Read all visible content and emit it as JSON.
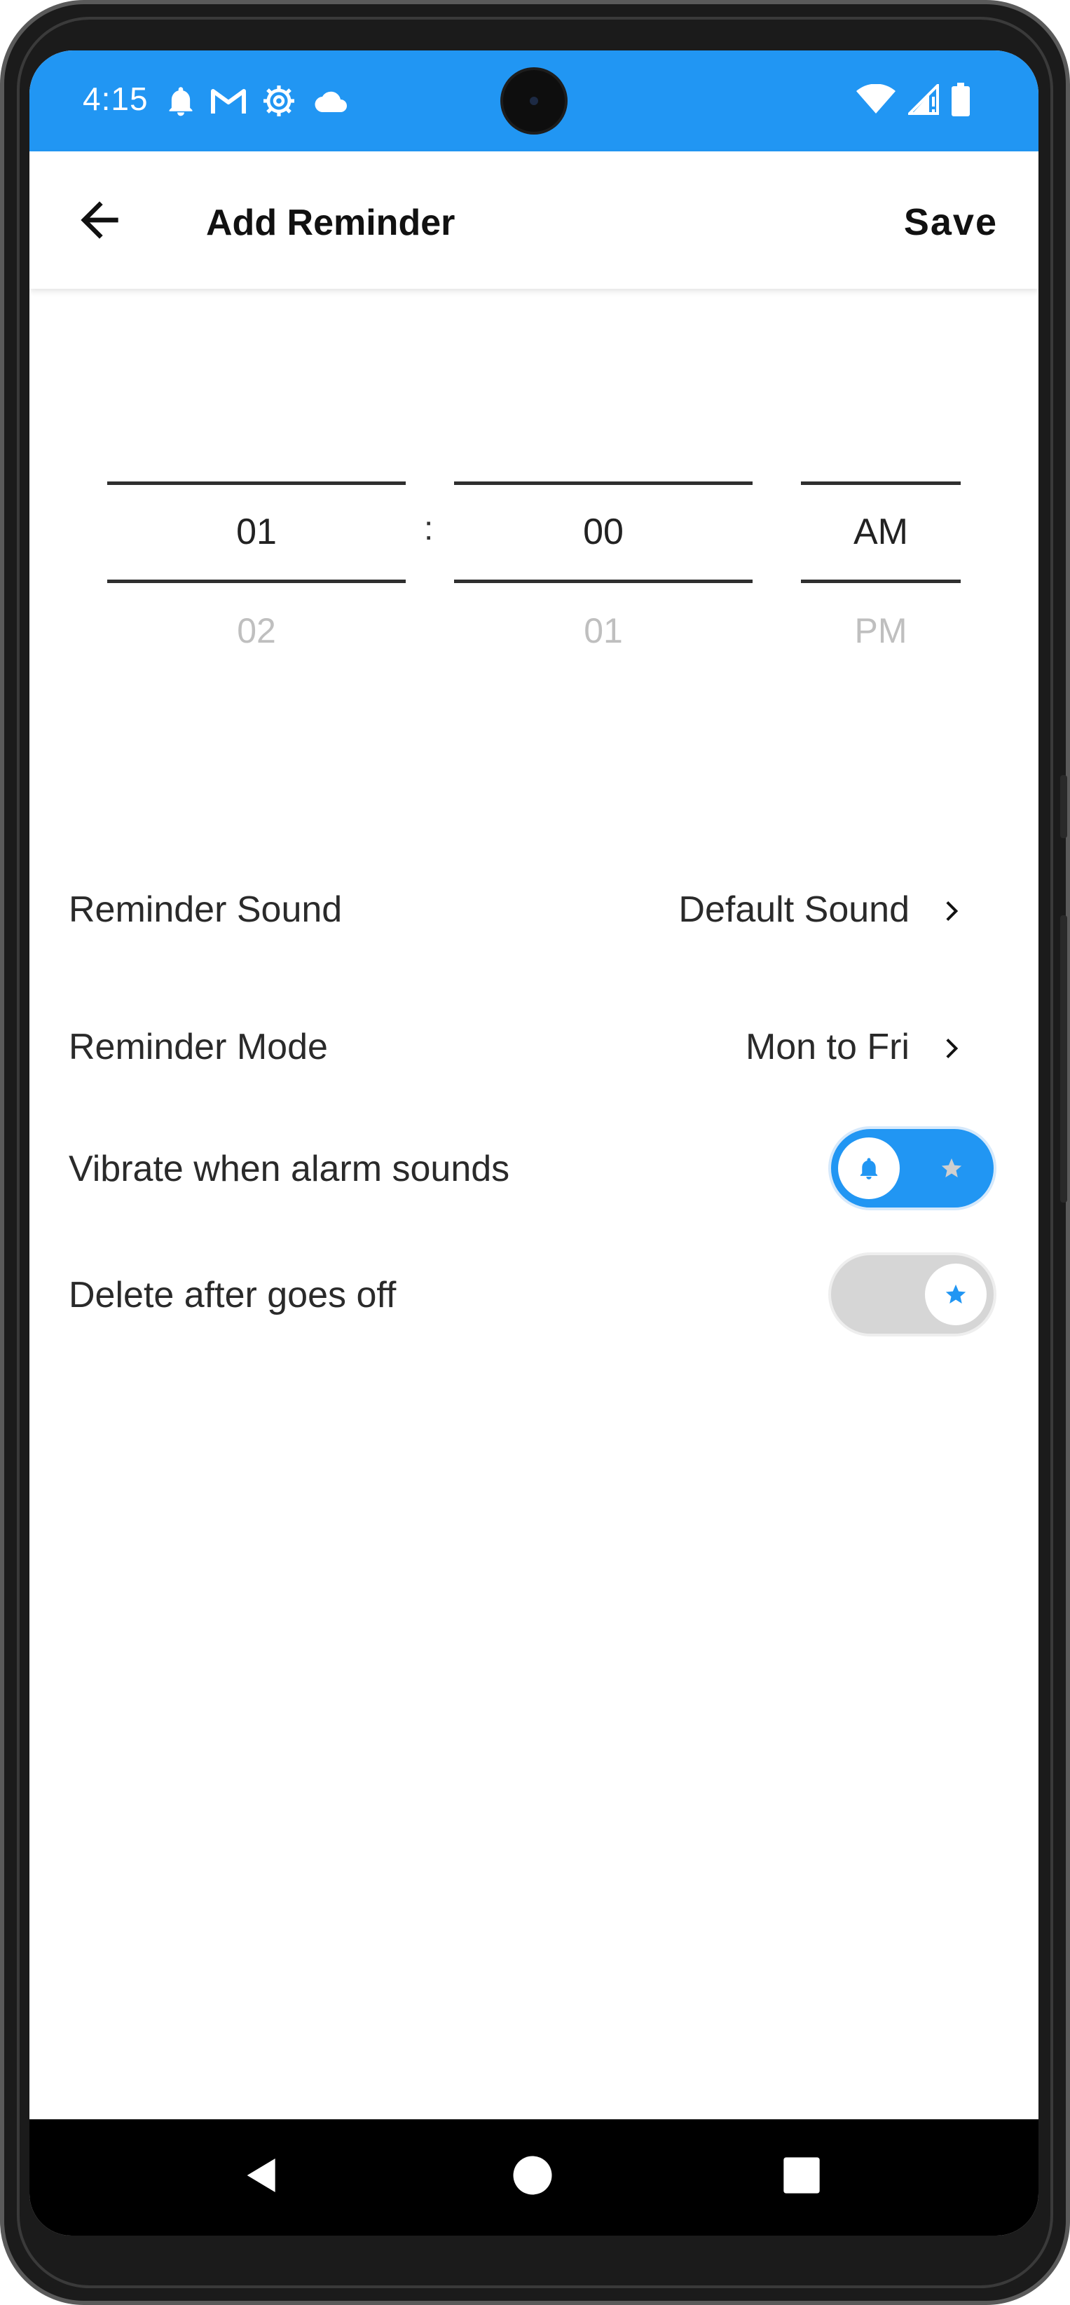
{
  "status_bar": {
    "time": "4:15",
    "left_icons": [
      "notification-bell-icon",
      "gmail-icon",
      "settings-gear-icon",
      "cloud-icon"
    ],
    "right_icons": [
      "wifi-icon",
      "cell-signal-icon",
      "battery-icon"
    ],
    "background_color": "#2196f3"
  },
  "app_bar": {
    "title": "Add Reminder",
    "save_label": "Save"
  },
  "time_picker": {
    "hour": {
      "selected": "01",
      "next": "02"
    },
    "separator": ":",
    "minute": {
      "selected": "00",
      "next": "01"
    },
    "period": {
      "selected": "AM",
      "next": "PM"
    }
  },
  "settings": {
    "sound": {
      "label": "Reminder Sound",
      "value": "Default Sound"
    },
    "mode": {
      "label": "Reminder Mode",
      "value": "Mon to Fri"
    },
    "vibrate": {
      "label": "Vibrate when alarm sounds",
      "enabled": true
    },
    "delete_after": {
      "label": "Delete after goes off",
      "enabled": false
    }
  },
  "nav_bar": {
    "buttons": [
      "back-triangle-icon",
      "home-circle-icon",
      "recents-square-icon"
    ]
  },
  "colors": {
    "accent": "#2196f3",
    "toggle_off": "#d6d6d6"
  }
}
